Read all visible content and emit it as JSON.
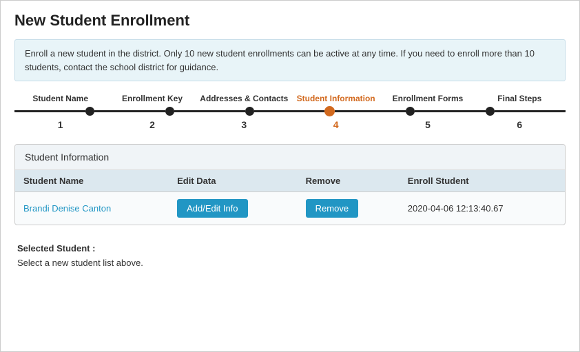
{
  "page": {
    "title": "New Student Enrollment",
    "info_banner": "Enroll a new student in the district. Only 10 new student enrollments can be active at any time. If you need to enroll more than 10 students, contact the school district for guidance."
  },
  "stepper": {
    "steps": [
      {
        "label": "Student Name",
        "number": "1",
        "active": false
      },
      {
        "label": "Enrollment Key",
        "number": "2",
        "active": false
      },
      {
        "label": "Addresses & Contacts",
        "number": "3",
        "active": false
      },
      {
        "label": "Student Information",
        "number": "4",
        "active": true
      },
      {
        "label": "Enrollment Forms",
        "number": "5",
        "active": false
      },
      {
        "label": "Final Steps",
        "number": "6",
        "active": false
      }
    ]
  },
  "content_card": {
    "header": "Student Information",
    "table": {
      "columns": [
        "Student Name",
        "Edit Data",
        "Remove",
        "Enroll Student"
      ],
      "rows": [
        {
          "student_name": "Brandi Denise Canton",
          "edit_button_label": "Add/Edit Info",
          "remove_button_label": "Remove",
          "enroll_student": "2020-04-06 12:13:40.67"
        }
      ]
    }
  },
  "selected_student": {
    "label": "Selected Student :",
    "hint": "Select a new student list above."
  },
  "colors": {
    "active": "#d2691e",
    "link": "#2196c4",
    "button_bg": "#2196c4",
    "track": "#222222",
    "table_header_bg": "#dce8ef",
    "card_bg": "#f9fbfc",
    "card_header_bg": "#f0f4f7"
  }
}
